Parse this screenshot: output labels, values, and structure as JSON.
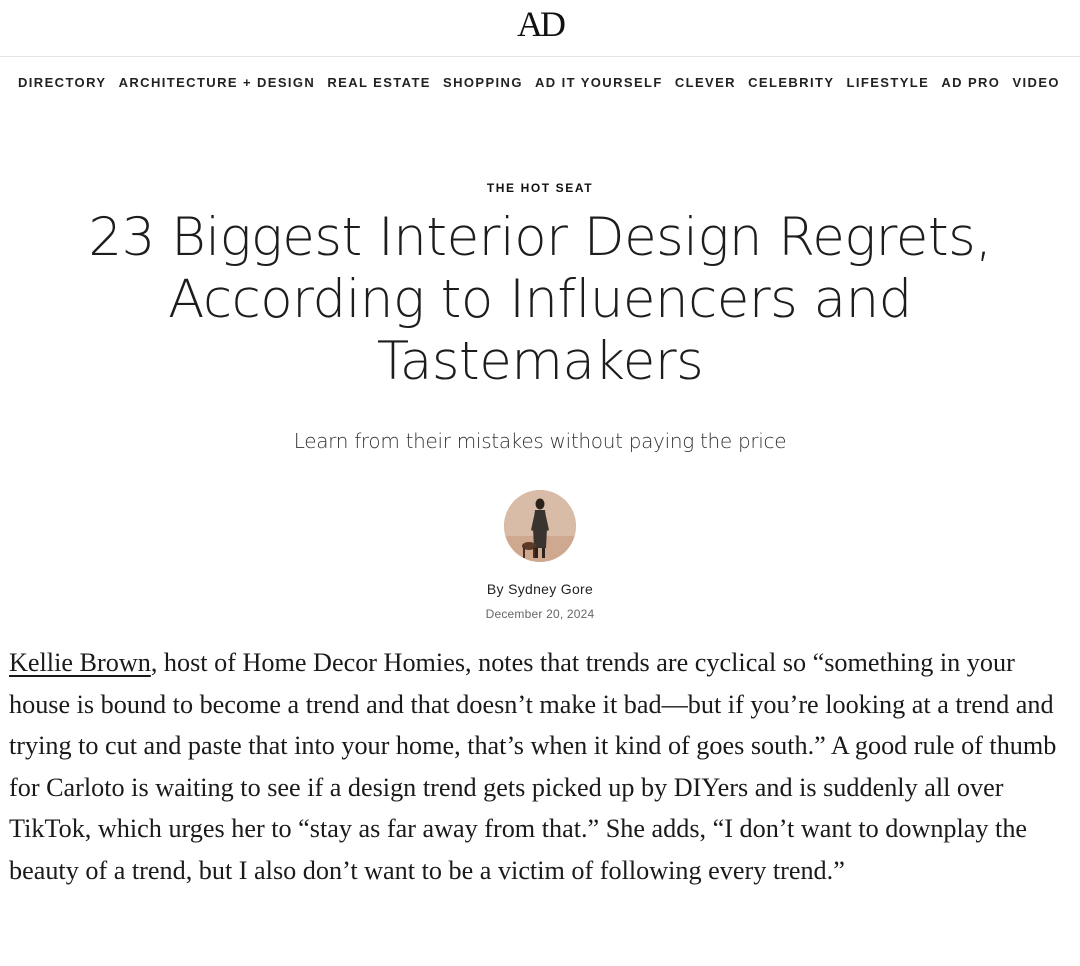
{
  "site": {
    "logo": "AD"
  },
  "nav": [
    "DIRECTORY",
    "ARCHITECTURE + DESIGN",
    "REAL ESTATE",
    "SHOPPING",
    "AD IT YOURSELF",
    "CLEVER",
    "CELEBRITY",
    "LIFESTYLE",
    "AD PRO",
    "VIDEO"
  ],
  "article": {
    "rubric": "THE HOT SEAT",
    "headline": "23 Biggest Interior Design Regrets, According to Influencers and Tastemakers",
    "dek": "Learn from their mistakes without paying the price",
    "byline_prefix": "By ",
    "author": "Sydney Gore",
    "date": "December 20, 2024",
    "body": {
      "link_text": "Kellie Brown",
      "text": ", host of Home Decor Homies, notes that trends are cyclical so “something in your house is bound to become a trend and that doesn’t make it bad—but if you’re looking at a trend and trying to cut and paste that into your home, that’s when it kind of goes south.” A good rule of thumb for Carloto is waiting to see if a design trend gets picked up by DIYers and is suddenly all over TikTok, which urges her to “stay as far away from that.” She adds, “I don’t want to downplay the beauty of a trend, but I also don’t want to be a victim of following every trend.”"
    }
  },
  "icons": {
    "author_avatar": "author-portrait"
  }
}
